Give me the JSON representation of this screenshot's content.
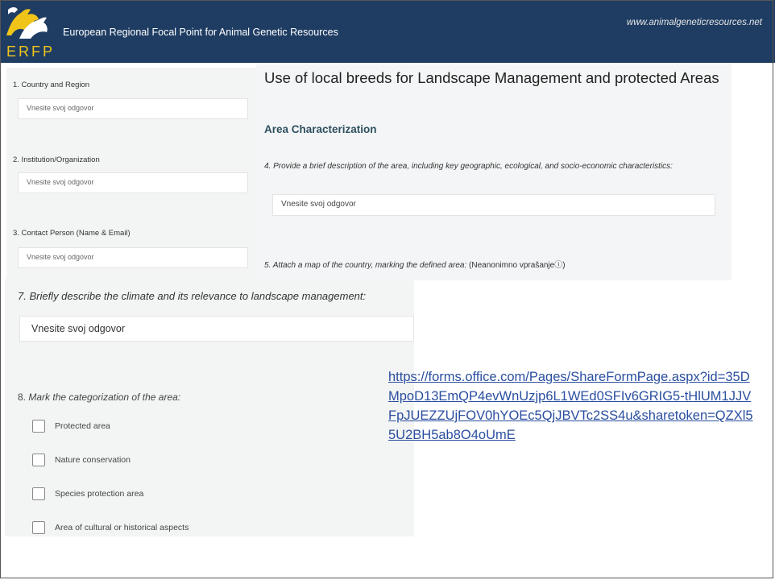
{
  "header": {
    "title": "European Regional Focal Point for Animal Genetic Resources",
    "website": "www.animalgeneticresources.net",
    "logo_text": "ERFP"
  },
  "colors": {
    "banner": "#1f3d63",
    "logo_accent": "#f0c419",
    "link": "#2a4ea0"
  },
  "form": {
    "title": "Use of local breeds for Landscape Management and protected Areas",
    "section": "Area Characterization",
    "placeholder": "Vnesite svoj odgovor",
    "q1": "1. Country and Region",
    "q2": "2. Institution/Organization",
    "q3": "3. Contact Person (Name & Email)",
    "q4": "4. Provide a brief description of the area, including key geographic, ecological, and socio-economic characteristics:",
    "q5_label": "5. Attach a map of the country, marking the defined area:",
    "q5_note": "(Neanonimno vprašanjeⓘ)",
    "q7": "7. Briefly describe the climate and its relevance to landscape management:",
    "q8_num": "8.",
    "q8_text": "Mark the categorization of the area:",
    "options": [
      "Protected area",
      "Nature conservation",
      "Species protection area",
      "Area of cultural or historical aspects"
    ]
  },
  "share_link": "https://forms.office.com/Pages/ShareFormPage.aspx?id=35DMpoD13EmQP4evWnUzjp6L1WEd0SFIv6GRIG5-tHlUM1JJVFpJUEZZUjFOV0hYOEc5QjJBVTc2SS4u&sharetoken=QZXl55U2BH5ab8O4oUmE"
}
